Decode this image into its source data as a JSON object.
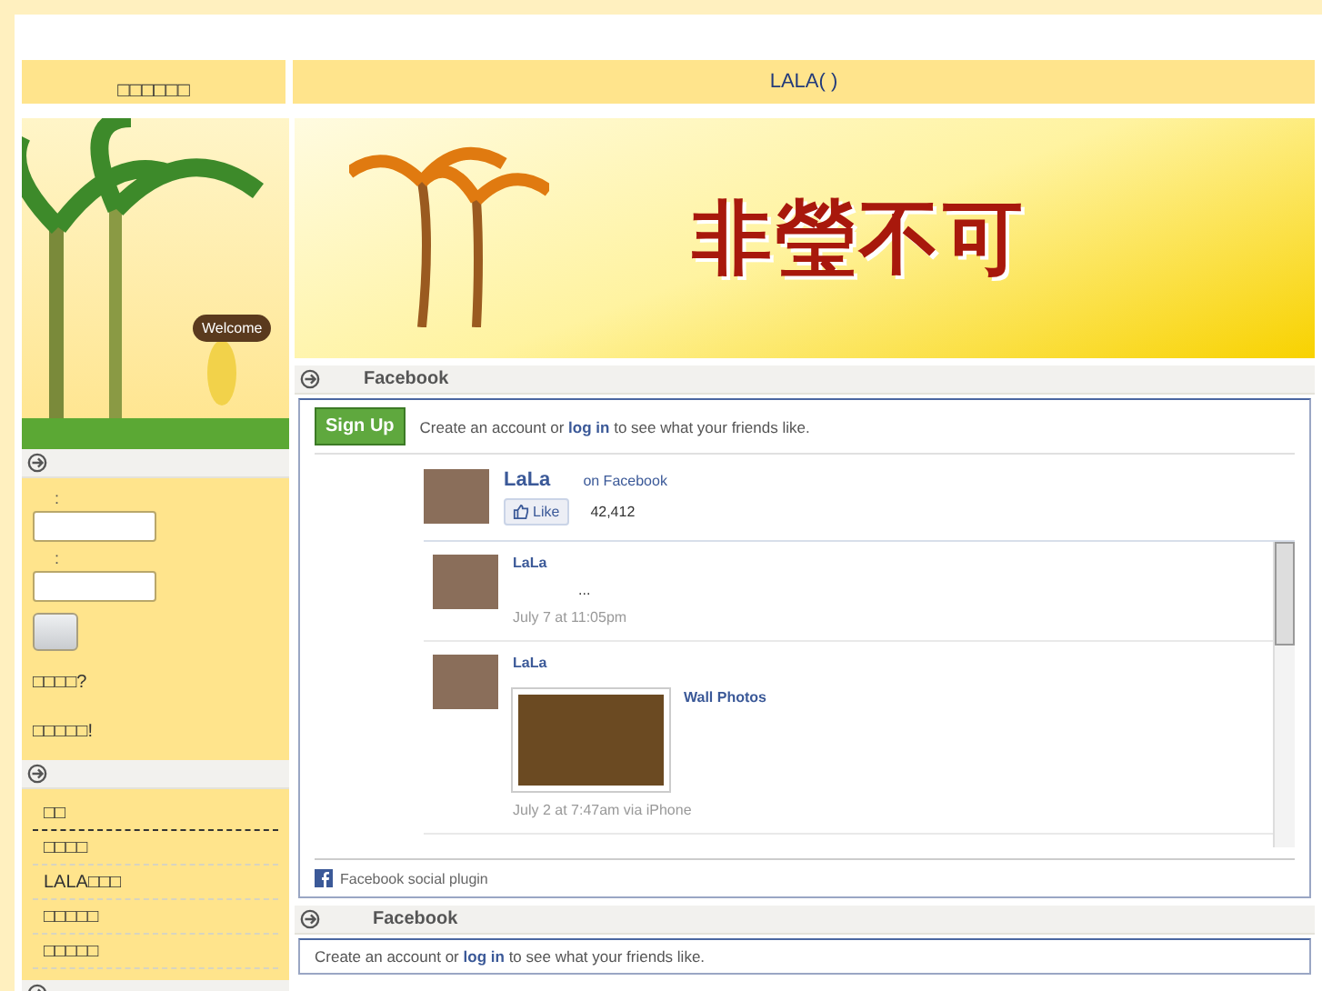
{
  "header": {
    "left_title": "□□□□□□",
    "right_title": "LALA(   )"
  },
  "sidebar": {
    "welcome": "Welcome",
    "login": {
      "user_label": ":",
      "password_label": ":",
      "links": [
        "□□□□?",
        "□□□□□!"
      ]
    },
    "menu": [
      {
        "label": "□□",
        "selected": true
      },
      {
        "label": "□□□□",
        "selected": false
      },
      {
        "label": "LALA□□□",
        "selected": false
      },
      {
        "label": "□□□□□",
        "selected": false
      },
      {
        "label": "□□□□□",
        "selected": false
      }
    ]
  },
  "banner": {
    "title": "非瑩不可"
  },
  "facebook_panels": [
    {
      "title": "Facebook",
      "signup": "Sign Up",
      "prompt_before": "Create an account or",
      "prompt_link": "log in",
      "prompt_after": "to see what your friends like.",
      "page": {
        "name": "LaLa",
        "on": "on Facebook",
        "like": "Like",
        "count": "42,412"
      },
      "posts": [
        {
          "author": "LaLa",
          "text": "...",
          "time": "July 7 at 11:05pm"
        },
        {
          "author": "LaLa",
          "album": "Wall Photos",
          "time": "July 2 at 7:47am via iPhone"
        }
      ],
      "footer": "Facebook social plugin"
    },
    {
      "title": "Facebook",
      "prompt_before": "Create an account or",
      "prompt_link": "log in",
      "prompt_after": "to see what your friends like."
    }
  ]
}
